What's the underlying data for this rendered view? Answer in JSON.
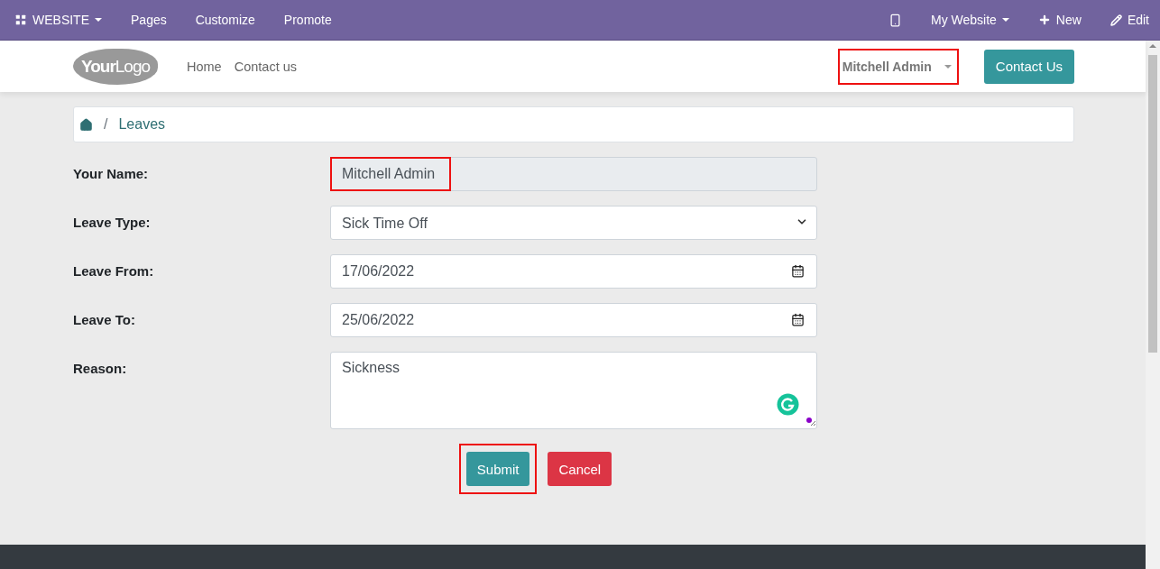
{
  "editor_bar": {
    "app_menu": "WEBSITE",
    "items": [
      "Pages",
      "Customize",
      "Promote"
    ],
    "website_menu": "My Website",
    "new_label": "New",
    "edit_label": "Edit"
  },
  "header": {
    "logo": {
      "bold": "Your",
      "light": "Logo"
    },
    "nav": [
      "Home",
      "Contact us"
    ],
    "user_menu": {
      "label": "Mitchell Admin",
      "highlighted": true
    },
    "contact_button": "Contact Us"
  },
  "breadcrumb": {
    "separator": "/",
    "current": "Leaves"
  },
  "form": {
    "fields": [
      {
        "kind": "readonly",
        "label": "Your Name:",
        "value": "Mitchell Admin",
        "highlighted": true
      },
      {
        "kind": "select",
        "label": "Leave Type:",
        "value": "Sick Time Off",
        "highlighted": false
      },
      {
        "kind": "date",
        "label": "Leave From:",
        "value": "17/06/2022",
        "highlighted": false
      },
      {
        "kind": "date",
        "label": "Leave To:",
        "value": "25/06/2022",
        "highlighted": false
      },
      {
        "kind": "textarea",
        "label": "Reason:",
        "value": "Sickness",
        "highlighted": false
      }
    ],
    "submit": {
      "label": "Submit",
      "highlighted": true
    },
    "cancel": {
      "label": "Cancel"
    }
  }
}
